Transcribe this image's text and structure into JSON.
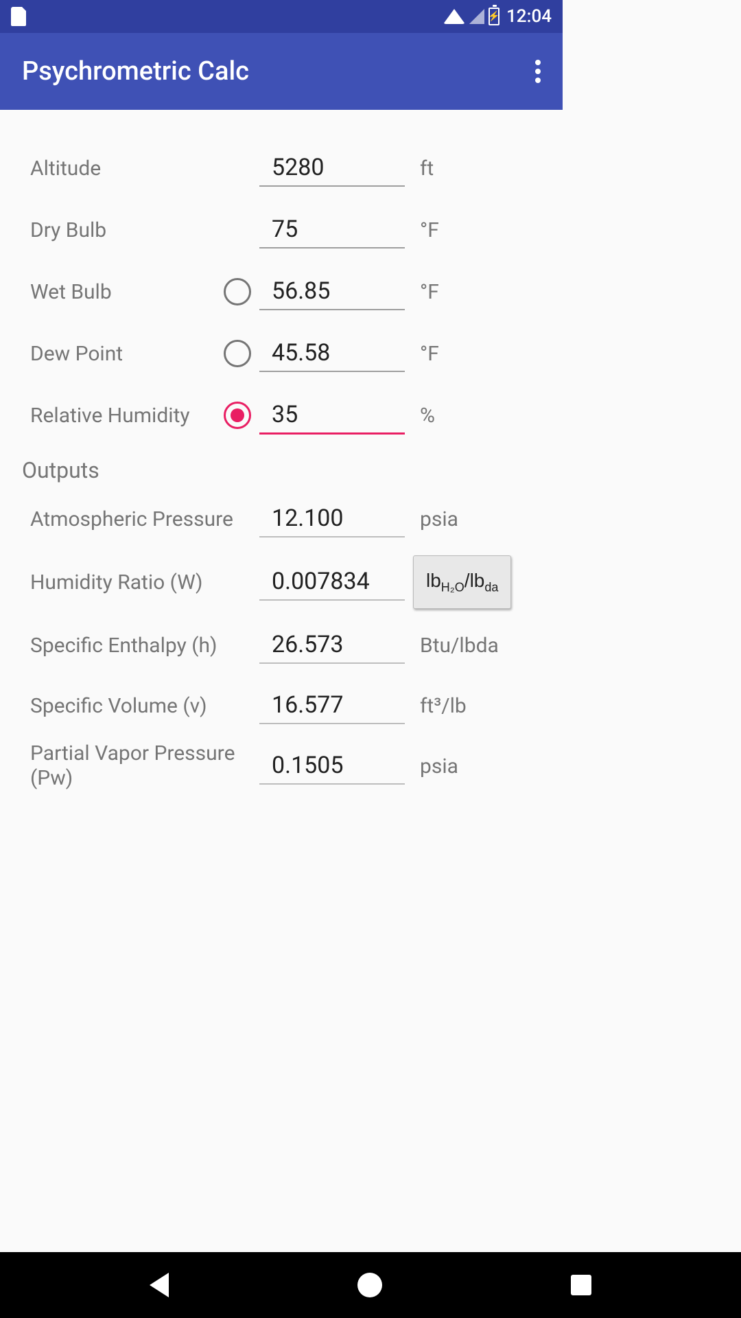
{
  "status": {
    "time": "12:04"
  },
  "app": {
    "title": "Psychrometric Calc"
  },
  "inputs": {
    "altitude": {
      "label": "Altitude",
      "value": "5280",
      "unit": "ft"
    },
    "dryBulb": {
      "label": "Dry Bulb",
      "value": "75",
      "unit": "°F"
    },
    "wetBulb": {
      "label": "Wet Bulb",
      "value": "56.85",
      "unit": "°F",
      "selected": false
    },
    "dewPoint": {
      "label": "Dew Point",
      "value": "45.58",
      "unit": "°F",
      "selected": false
    },
    "relativeHumidity": {
      "label": "Relative Humidity",
      "value": "35",
      "unit": "%",
      "selected": true
    }
  },
  "outputsHeader": "Outputs",
  "outputs": {
    "atmosphericPressure": {
      "label": "Atmospheric Pressure",
      "value": "12.100",
      "unit": "psia"
    },
    "humidityRatio": {
      "label": "Humidity Ratio (W)",
      "value": "0.007834",
      "unitButton": "lbH₂O/lbda"
    },
    "specificEnthalpy": {
      "label": "Specific Enthalpy (h)",
      "value": "26.573",
      "unit": "Btu/lbda"
    },
    "specificVolume": {
      "label": "Specific Volume (v)",
      "value": "16.577",
      "unit": "ft³/lb"
    },
    "partialVaporPressure": {
      "label": "Partial Vapor Pressure (Pw)",
      "value": "0.1505",
      "unit": "psia"
    }
  }
}
